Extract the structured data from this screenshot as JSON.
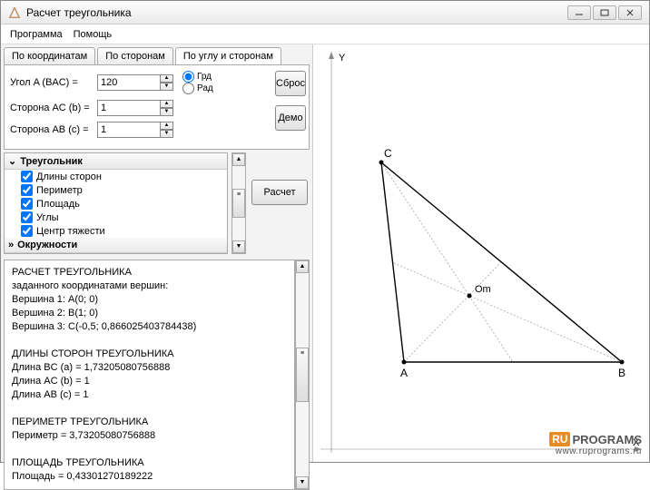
{
  "window": {
    "title": "Расчет треугольника"
  },
  "menu": {
    "program": "Программа",
    "help": "Помощь"
  },
  "tabs": {
    "coords": "По координатам",
    "sides": "По сторонам",
    "angle_sides": "По углу и сторонам"
  },
  "inputs": {
    "angle_label": "Угол A (BAC) =",
    "angle_value": "120",
    "side_ac_label": "Сторона AC (b) =",
    "side_ac_value": "1",
    "side_ab_label": "Сторона AB (c) =",
    "side_ab_value": "1",
    "unit_deg": "Грд",
    "unit_rad": "Рад"
  },
  "buttons": {
    "reset": "Сброс",
    "demo": "Демо",
    "calc": "Расчет"
  },
  "options": {
    "header_triangle": "Треугольник",
    "rows": [
      "Длины сторон",
      "Периметр",
      "Площадь",
      "Углы",
      "Центр тяжести"
    ],
    "header_circles": "Окружности"
  },
  "results": "РАСЧЕТ ТРЕУГОЛЬНИКА\nзаданного координатами вершин:\n Вершина 1: A(0; 0)\n Вершина 2: B(1; 0)\n Вершина 3: C(-0,5; 0,866025403784438)\n\nДЛИНЫ СТОРОН ТРЕУГОЛЬНИКА\n Длина BC (a) = 1,73205080756888\n Длина AC (b) = 1\n Длина AB (c) = 1\n\nПЕРИМЕТР ТРЕУГОЛЬНИКА\n Периметр = 3,73205080756888\n\nПЛОЩАДЬ ТРЕУГОЛЬНИКА\n Площадь = 0,43301270189222",
  "axes": {
    "y": "Y",
    "x": "X"
  },
  "triangle": {
    "A": "A",
    "B": "B",
    "C": "C",
    "Om": "Om"
  },
  "watermark": {
    "ru": "RU",
    "text": "PROGRAMS",
    "url": "www.ruprograms.ru"
  }
}
